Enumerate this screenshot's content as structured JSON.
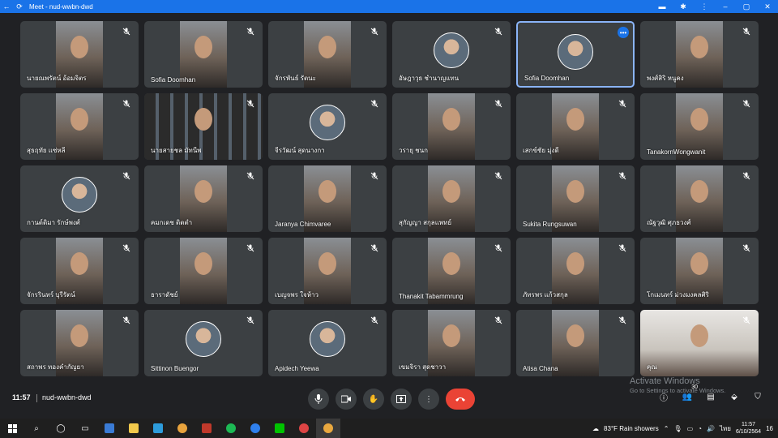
{
  "window": {
    "title": "Meet - nud-wwbn-dwd"
  },
  "participants": [
    {
      "name": "นายณพรัตน์ อ้อมจิตร",
      "type": "video"
    },
    {
      "name": "Sofia Doomhan",
      "type": "video"
    },
    {
      "name": "จักรพันธ์ รัตนะ",
      "type": "video"
    },
    {
      "name": "อัษฎาวุธ ชำนาญแทน",
      "type": "avatar"
    },
    {
      "name": "Sofia Doomhan",
      "type": "avatar",
      "active": true
    },
    {
      "name": "พงศ์สิริ หนูคง",
      "type": "video"
    },
    {
      "name": "สุธฤทัย แซ่หลี",
      "type": "video"
    },
    {
      "name": "นายสายชล มัทนีพ",
      "type": "screen"
    },
    {
      "name": "จีรวัฒน์ สุดนางกา",
      "type": "avatar"
    },
    {
      "name": "วรายุ ชนก",
      "type": "video"
    },
    {
      "name": "เสกข์ชัย มุ่งดี",
      "type": "video"
    },
    {
      "name": "TanakornWongwanit",
      "type": "video"
    },
    {
      "name": "กานต์ติมา รักษ์พงศ์",
      "type": "avatar"
    },
    {
      "name": "คมกเดช ติตตำ",
      "type": "video"
    },
    {
      "name": "Jaranya Chimvaree",
      "type": "video"
    },
    {
      "name": "สุกัญญา สกุลแพทย์",
      "type": "video"
    },
    {
      "name": "Sukita Rungsuwan",
      "type": "video"
    },
    {
      "name": "ณัฐวุฒิ ศุภธวงศ์",
      "type": "video"
    },
    {
      "name": "จักรรินทร์ บุรีรัตน์",
      "type": "video"
    },
    {
      "name": "ธาราดัชย์",
      "type": "video"
    },
    {
      "name": "เบญจพร ใจห้าว",
      "type": "video"
    },
    {
      "name": "Thanakit Tabammrung",
      "type": "video"
    },
    {
      "name": "ภัทรพร แก้วสกุล",
      "type": "video"
    },
    {
      "name": "โกเมนทร์ ม่วงมงคลศิริ",
      "type": "video"
    },
    {
      "name": "สถาพร ทองคำกัญยา",
      "type": "video"
    },
    {
      "name": "Sittinon Buengor",
      "type": "avatar"
    },
    {
      "name": "Apidech Yeewa",
      "type": "avatar"
    },
    {
      "name": "เขมจิรา สุดชาวา",
      "type": "video"
    },
    {
      "name": "Atisa Chana",
      "type": "video"
    },
    {
      "name": "คุณ",
      "type": "wide"
    }
  ],
  "bottom": {
    "time": "11:57",
    "meeting_code": "nud-wwbn-dwd",
    "people_count": "30"
  },
  "watermark": {
    "title": "Activate Windows",
    "subtitle": "Go to Settings to activate Windows."
  },
  "taskbar": {
    "weather": "83°F  Rain showers",
    "lang": "ไทย",
    "clock_time": "11:57",
    "clock_date": "6/10/2564",
    "notif": "16"
  },
  "colors": {
    "accent": "#1a73e8",
    "end_call": "#ea4335",
    "tile": "#3c4043",
    "background": "#202124"
  }
}
